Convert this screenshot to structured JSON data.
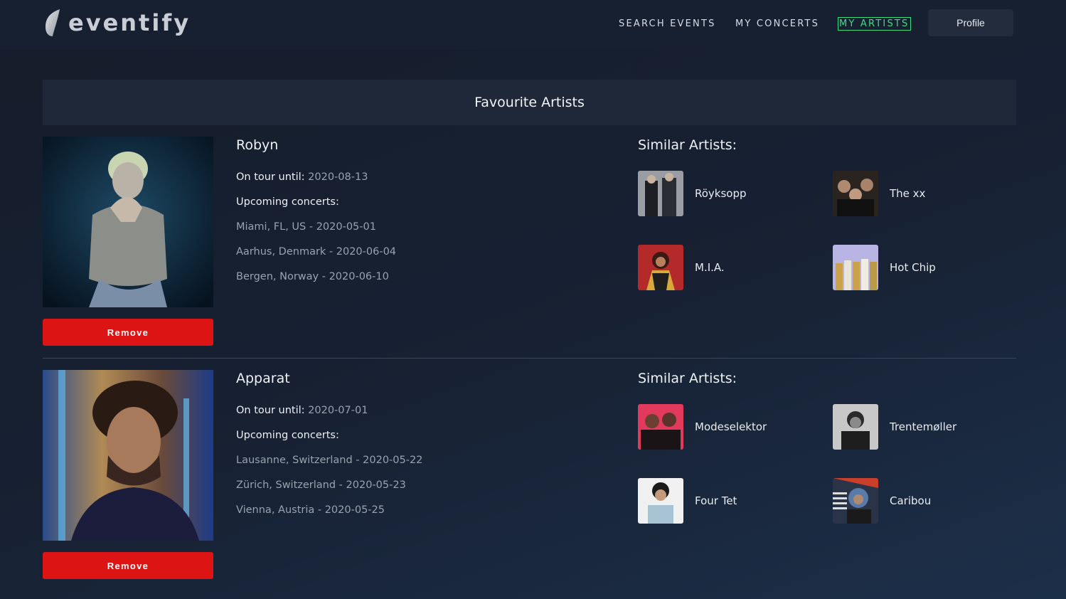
{
  "brand": {
    "name": "eventify"
  },
  "nav": {
    "search_events": "SEARCH EVENTS",
    "my_concerts": "MY CONCERTS",
    "my_artists": "MY ARTISTS",
    "profile": "Profile"
  },
  "page": {
    "title": "Favourite Artists"
  },
  "labels": {
    "on_tour_until": "On tour until:",
    "upcoming_concerts": "Upcoming concerts:",
    "similar_artists": "Similar Artists:",
    "remove": "Remove"
  },
  "artists": [
    {
      "name": "Robyn",
      "on_tour_until": "2020-08-13",
      "concerts": [
        "Miami, FL, US - 2020-05-01",
        "Aarhus, Denmark - 2020-06-04",
        "Bergen, Norway - 2020-06-10"
      ],
      "similar": [
        "Röyksopp",
        "The xx",
        "M.I.A.",
        "Hot Chip"
      ]
    },
    {
      "name": "Apparat",
      "on_tour_until": "2020-07-01",
      "concerts": [
        "Lausanne, Switzerland - 2020-05-22",
        "Zürich, Switzerland - 2020-05-23",
        "Vienna, Austria - 2020-05-25"
      ],
      "similar": [
        "Modeselektor",
        "Trentemøller",
        "Four Tet",
        "Caribou"
      ]
    }
  ],
  "colors": {
    "background": "#161d2b",
    "accent_active": "#3ddc84",
    "remove_button": "#dc1414"
  }
}
